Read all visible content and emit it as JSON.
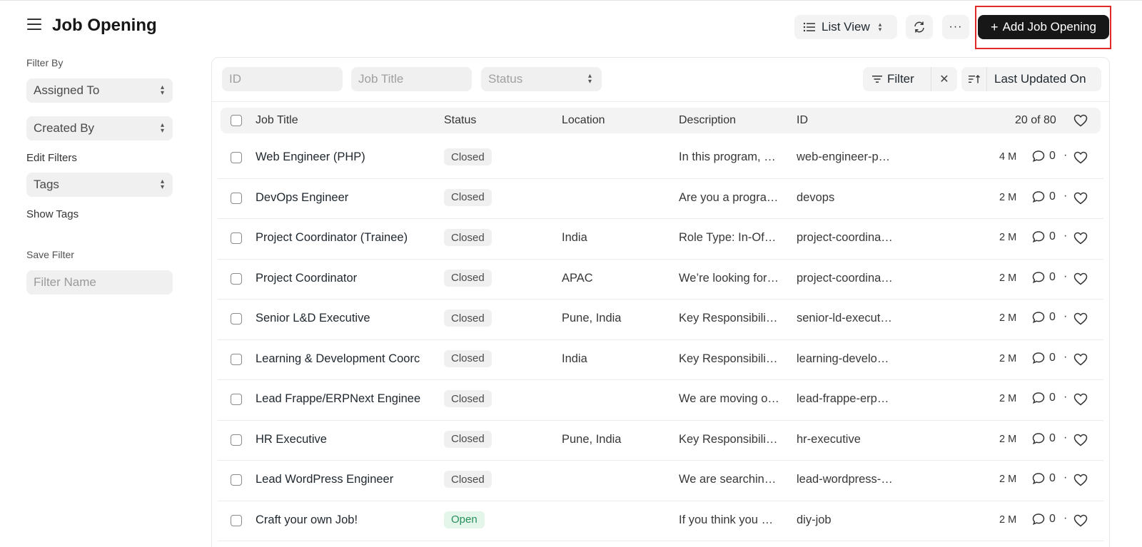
{
  "header": {
    "title": "Job Opening",
    "list_view_label": "List View",
    "more_label": "···",
    "add_button_label": "Add Job Opening",
    "add_button_icon": "+"
  },
  "sidebar": {
    "filter_by_label": "Filter By",
    "assigned_to": "Assigned To",
    "created_by": "Created By",
    "edit_filters": "Edit Filters",
    "tags": "Tags",
    "show_tags": "Show Tags",
    "save_filter_label": "Save Filter",
    "filter_name_placeholder": "Filter Name"
  },
  "filters": {
    "id_placeholder": "ID",
    "job_title_placeholder": "Job Title",
    "status_placeholder": "Status",
    "filter_label": "Filter",
    "sort_label": "Last Updated On"
  },
  "table": {
    "columns": {
      "job_title": "Job Title",
      "status": "Status",
      "location": "Location",
      "description": "Description",
      "id": "ID"
    },
    "count": "20 of 80",
    "rows": [
      {
        "title": "Web Engineer (PHP)",
        "status": "Closed",
        "location": "",
        "description": "In this program, …",
        "id": "web-engineer-p…",
        "modified": "4 M",
        "comments": "0",
        "dot": "·"
      },
      {
        "title": "DevOps Engineer",
        "status": "Closed",
        "location": "",
        "description": "Are you a progra…",
        "id": "devops",
        "modified": "2 M",
        "comments": "0",
        "dot": "·"
      },
      {
        "title": "Project Coordinator (Trainee)",
        "status": "Closed",
        "location": "India",
        "description": "Role Type: In-Of…",
        "id": "project-coordina…",
        "modified": "2 M",
        "comments": "0",
        "dot": "·"
      },
      {
        "title": "Project Coordinator",
        "status": "Closed",
        "location": "APAC",
        "description": "We’re looking for…",
        "id": "project-coordina…",
        "modified": "2 M",
        "comments": "0",
        "dot": "·"
      },
      {
        "title": "Senior L&D Executive",
        "status": "Closed",
        "location": "Pune, India",
        "description": "Key Responsibili…",
        "id": "senior-ld-execut…",
        "modified": "2 M",
        "comments": "0",
        "dot": "·"
      },
      {
        "title": "Learning & Development Coorc",
        "status": "Closed",
        "location": "India",
        "description": "Key Responsibili…",
        "id": "learning-develo…",
        "modified": "2 M",
        "comments": "0",
        "dot": "·"
      },
      {
        "title": "Lead Frappe/ERPNext Enginee",
        "status": "Closed",
        "location": "",
        "description": "We are moving o…",
        "id": "lead-frappe-erp…",
        "modified": "2 M",
        "comments": "0",
        "dot": "·"
      },
      {
        "title": "HR Executive",
        "status": "Closed",
        "location": "Pune, India",
        "description": "Key Responsibili…",
        "id": "hr-executive",
        "modified": "2 M",
        "comments": "0",
        "dot": "·"
      },
      {
        "title": "Lead WordPress Engineer",
        "status": "Closed",
        "location": "",
        "description": "We are searchin…",
        "id": "lead-wordpress-…",
        "modified": "2 M",
        "comments": "0",
        "dot": "·"
      },
      {
        "title": "Craft your own Job!",
        "status": "Open",
        "location": "",
        "description": "If you think you …",
        "id": "diy-job",
        "modified": "2 M",
        "comments": "0",
        "dot": "·"
      }
    ]
  },
  "colors": {
    "primary_button": "#171717",
    "open_badge_bg": "#e4f5e9",
    "open_badge_text": "#278f5e",
    "highlight_box": "#e02a2a"
  }
}
